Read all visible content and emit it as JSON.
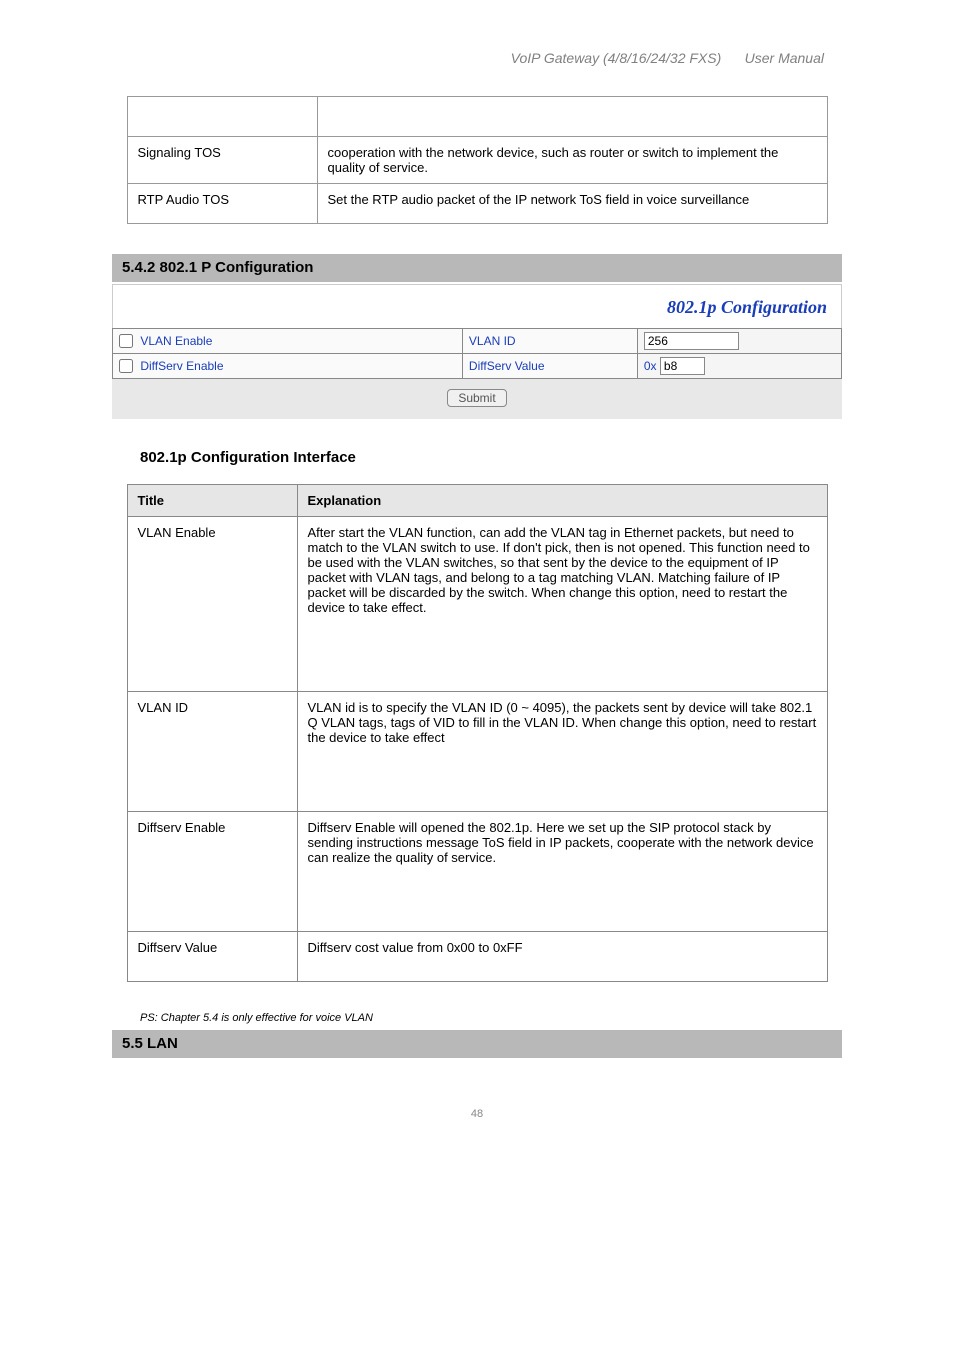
{
  "doc": {
    "header_product": "VoIP Gateway (4/8/16/24/32 FXS)",
    "header_doc": "User Manual",
    "page_number": "48"
  },
  "tos_table": {
    "r1": {
      "label": "",
      "desc": ""
    },
    "r2": {
      "label": "Signaling TOS",
      "desc": "cooperation with the network device, such as router or switch to implement the quality of service."
    },
    "r3": {
      "label": "RTP Audio TOS",
      "desc": "Set the RTP audio packet of the IP network ToS field in voice surveillance"
    }
  },
  "section_802_title": "5.4.2 802.1 P Configuration",
  "config_panel": {
    "title": "802.1p Configuration",
    "vlan_enable_label": "VLAN Enable",
    "vlan_id_label": "VLAN ID",
    "vlan_id_value": "256",
    "diffserv_enable_label": "DiffServ Enable",
    "diffserv_value_label": "DiffServ Value",
    "diffserv_prefix": "0x",
    "diffserv_value": "b8",
    "submit_label": "Submit"
  },
  "figure_caption": "802.1p Configuration Interface",
  "desc_table": {
    "h1": "Title",
    "h2": "Explanation",
    "r1": {
      "label": "VLAN Enable",
      "desc": "After start the VLAN function, can add the VLAN tag in Ethernet packets, but need to match to the VLAN switch to use. If don't pick, then is not opened. This function need to be used with the VLAN switches, so that sent by the device to the equipment of IP packet with VLAN tags, and belong to a tag matching VLAN. Matching failure of IP packet will be discarded by the switch. When change this option, need to restart the device to take effect."
    },
    "r2": {
      "label": "VLAN ID",
      "desc": "VLAN id is to specify the VLAN ID (0 ~ 4095), the packets sent by device will take 802.1 Q VLAN tags, tags of VID to fill in the VLAN ID. When change this option, need to restart the device to take effect"
    },
    "r3": {
      "label": "Diffserv Enable",
      "desc": "Diffserv Enable will opened the 802.1p. Here we set up the SIP protocol stack by sending instructions message ToS field in IP packets, cooperate with the network device can realize the quality of service."
    },
    "r4": {
      "label": "Diffserv Value",
      "desc": "Diffserv cost value from 0x00 to 0xFF"
    }
  },
  "footnote": "PS: Chapter 5.4 is only effective for voice VLAN",
  "section_lan_title": "5.5 LAN"
}
